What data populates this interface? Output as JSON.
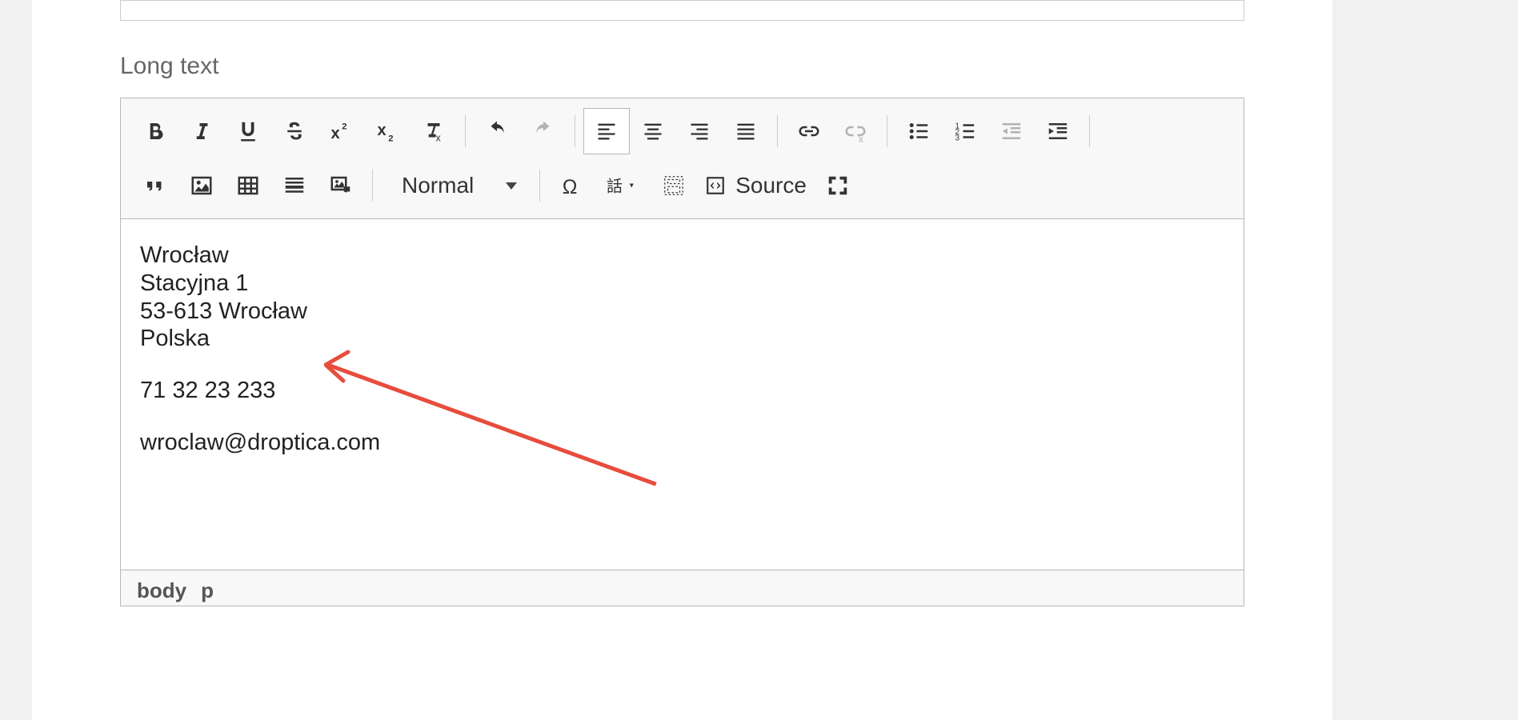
{
  "field": {
    "label": "Long text"
  },
  "toolbar": {
    "format_combo": "Normal",
    "source_label": "Source"
  },
  "content": {
    "para1": {
      "l1": "Wrocław",
      "l2": "Stacyjna 1",
      "l3": "53-613 Wrocław",
      "l4": "Polska"
    },
    "para2": "71 32 23 233",
    "para3": "wroclaw@droptica.com"
  },
  "path": {
    "el1": "body",
    "el2": "p"
  },
  "colors": {
    "arrow": "#e74c3c"
  }
}
